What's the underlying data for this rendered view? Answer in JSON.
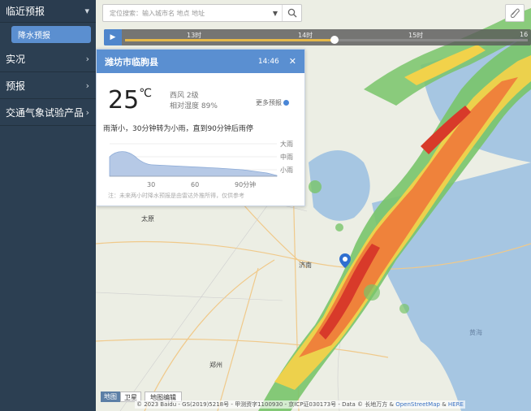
{
  "sidebar": {
    "items": [
      {
        "label": "临近预报",
        "chevron": "chevron-down-icon"
      },
      {
        "label": "降水预报"
      },
      {
        "label": "实况",
        "chevron": "chevron-right-icon"
      },
      {
        "label": "预报",
        "chevron": "chevron-right-icon"
      },
      {
        "label": "交通气象试验产品",
        "chevron": "chevron-right-icon"
      }
    ]
  },
  "search": {
    "placeholder": "定位搜索：输入城市名 地点 地址"
  },
  "timeline": {
    "labels": [
      "13时",
      "14时",
      "15时",
      "16"
    ],
    "current_fraction": 0.52
  },
  "popup": {
    "place": "潍坊市临朐县",
    "time": "14:46",
    "temp": "25",
    "temp_unit": "℃",
    "wind": "西风 2级",
    "humidity": "相对湿度 89%",
    "more": "更多预报",
    "description": "雨渐小，30分钟转为小雨，直到90分钟后雨停",
    "chart": {
      "x_ticks": [
        "30",
        "60",
        "90分钟"
      ],
      "levels": [
        "大雨",
        "中雨",
        "小雨"
      ]
    },
    "note": "注：未来两小时降水预报是由雷达外推所得，仅供参考"
  },
  "map": {
    "cities": [
      "太原",
      "济南",
      "郑州"
    ],
    "sea_label": "黄海"
  },
  "basemap": {
    "active": "地图",
    "sat": "卫星",
    "edit": "地图编辑"
  },
  "copyright": {
    "text": "© 2023 Baidu - GS(2019)5218号 - 甲测资字1100930 - 京ICP证030173号 - Data © 长地万方 &",
    "osm": "OpenStreetMap",
    "amp": "&",
    "here": "HERE"
  },
  "colors": {
    "sidebar": "#2c3f52",
    "accent": "#5a8fd1",
    "timeline_fill": "#e5b84a"
  }
}
